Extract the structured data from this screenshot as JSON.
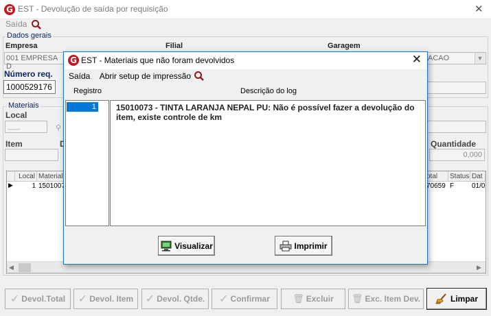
{
  "main_window": {
    "title": "EST -  Devolução de saída por requisição",
    "close_glyph": "✕",
    "menu": {
      "exit_label": "Saída"
    },
    "general_data": {
      "group_label": "Dados gerais",
      "empresa_label": "Empresa",
      "empresa_value": "001 EMPRESA D",
      "filial_label": "Filial",
      "garagem_label": "Garagem",
      "garagem_value": "ACAO",
      "numero_req_label": "Número req.",
      "numero_req_value": "1000529176"
    },
    "materials": {
      "group_label": "Materiais",
      "local_label": "Local",
      "local_value": "___",
      "item_label": "Item",
      "d_label": "D",
      "quantidade_label": "Quantidade",
      "quantidade_value": "0,000",
      "grid": {
        "col_local": "Local",
        "col_material": "Material",
        "col_total": "otal",
        "col_status": "Status",
        "col_date": "Dat",
        "row_local": "1",
        "row_material": "15010073",
        "row_total": "70659",
        "row_status": "F",
        "row_date": "01/0"
      }
    },
    "buttons": {
      "devol_total": "Devol.Total",
      "devol_item": "Devol. Item",
      "devol_qtde": "Devol. Qtde.",
      "confirmar": "Confirmar",
      "excluir": "Excluir",
      "exc_item_dev": "Exc. Item Dev.",
      "limpar": "Limpar"
    }
  },
  "dialog": {
    "title": "EST - Materiais que não foram devolvidos",
    "close_glyph": "✕",
    "menu": {
      "exit_label": "Saída",
      "print_setup_label": "Abrir setup de impressão"
    },
    "columns": {
      "registro": "Registro",
      "descricao": "Descrição do log"
    },
    "records": [
      {
        "registro": "1",
        "descricao": "15010073 - TINTA LARANJA NEPAL PU: Não é possível fazer a devolução do item, existe controle de km"
      }
    ],
    "buttons": {
      "visualizar": "Visualizar",
      "imprimir": "Imprimir"
    }
  },
  "icons": {
    "logo": "app-logo-icon",
    "search": "magnifier-icon",
    "close": "close-icon",
    "monitor": "monitor-icon",
    "printer": "printer-icon",
    "check": "check-icon",
    "trash": "trash-icon",
    "broom": "broom-icon"
  },
  "colors": {
    "logo_red": "#c2181f",
    "selection_blue": "#0078d7",
    "dialog_border": "#1e70c8",
    "label_navy": "#0a246a"
  }
}
